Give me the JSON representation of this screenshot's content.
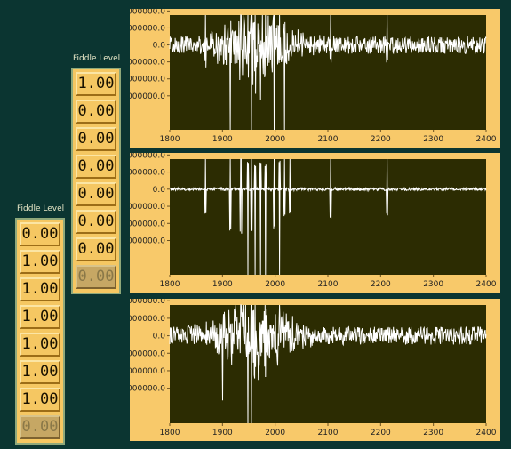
{
  "arrays": [
    {
      "label": "Fiddle Level",
      "values": [
        "1.00",
        "0.00",
        "0.00",
        "0.00",
        "0.00",
        "0.00",
        "0.00",
        "0.00"
      ]
    },
    {
      "label": "Fiddle Level",
      "values": [
        "0.00",
        "1.00",
        "1.00",
        "1.00",
        "1.00",
        "1.00",
        "1.00",
        "0.00"
      ]
    }
  ],
  "colors": {
    "background": "#0b3531",
    "panel": "#f8c96a",
    "plot": "#2c2c02",
    "trace": "#ffffff"
  },
  "chart_data": [
    {
      "type": "line",
      "title": "",
      "xlabel": "",
      "ylabel": "",
      "xlim": [
        1800,
        2400
      ],
      "x_ticks": [
        "1800",
        "1900",
        "2000",
        "2100",
        "2200",
        "2300",
        "2400"
      ],
      "y_ticks": [
        "000000.0",
        "000000.0",
        "0.0",
        "000000.0",
        "000000.0",
        "000000.0"
      ],
      "grid": false,
      "events": [
        [
          1868,
          6
        ],
        [
          1915,
          -9
        ],
        [
          1935,
          12
        ],
        [
          1948,
          8
        ],
        [
          1955,
          -14
        ],
        [
          1962,
          13
        ],
        [
          1972,
          -5
        ],
        [
          1982,
          6
        ],
        [
          1998,
          -8
        ],
        [
          2008,
          7
        ],
        [
          2018,
          -6
        ],
        [
          2105,
          5
        ],
        [
          2212,
          8
        ]
      ],
      "envelope": {
        "center": 1960,
        "width": 75,
        "amplitude": 4.5
      },
      "noise": 1.2
    },
    {
      "type": "line",
      "title": "",
      "xlabel": "",
      "ylabel": "",
      "xlim": [
        1800,
        2400
      ],
      "x_ticks": [
        "1800",
        "1900",
        "2000",
        "2100",
        "2200",
        "2300",
        "2400"
      ],
      "y_ticks": [
        "000000.0",
        "000000.0",
        "0.0",
        "000000.0",
        "000000.0",
        "000000.0"
      ],
      "grid": false,
      "events": [
        [
          1868,
          9
        ],
        [
          1915,
          16
        ],
        [
          1935,
          17
        ],
        [
          1948,
          -10
        ],
        [
          1955,
          16
        ],
        [
          1962,
          -9
        ],
        [
          1972,
          -10
        ],
        [
          1982,
          -9
        ],
        [
          1998,
          15
        ],
        [
          2008,
          -11
        ],
        [
          2018,
          10
        ],
        [
          2028,
          9
        ],
        [
          2105,
          11
        ],
        [
          2212,
          10
        ]
      ],
      "envelope": {
        "center": 1960,
        "width": 75,
        "amplitude": 0
      },
      "noise": 0.2
    },
    {
      "type": "line",
      "title": "",
      "xlabel": "",
      "ylabel": "",
      "xlim": [
        1800,
        2400
      ],
      "x_ticks": [
        "1800",
        "1900",
        "2000",
        "2100",
        "2200",
        "2300",
        "2400"
      ],
      "y_ticks": [
        "000000.0",
        "000000.0",
        "0.0",
        "000000.0",
        "000000.0",
        "000000.0"
      ],
      "grid": false,
      "events": [
        [
          1900,
          -3
        ],
        [
          1935,
          6
        ],
        [
          1948,
          -5
        ],
        [
          1955,
          -10
        ],
        [
          1962,
          9
        ],
        [
          1982,
          -4
        ],
        [
          2008,
          3
        ]
      ],
      "envelope": {
        "center": 1960,
        "width": 70,
        "amplitude": 5
      },
      "noise": 1.2
    }
  ]
}
